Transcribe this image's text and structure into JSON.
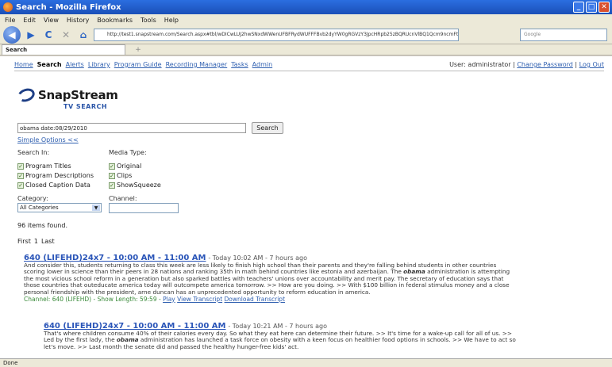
{
  "window": {
    "title": "Search - Mozilla Firefox"
  },
  "menu": [
    "File",
    "Edit",
    "View",
    "History",
    "Bookmarks",
    "Tools",
    "Help"
  ],
  "browser": {
    "url": "http://test1.snapstream.com/Search.aspx#tbl/wDICwLUJ2hwSNxdWWenUFBFRydWUFFFBvb2dyYW0gRGVzY3JpcHRpb25zBQRUcnVlBQ1Qcm9ncmFtVGlt",
    "search_placeholder": "Google",
    "tab_label": "Search"
  },
  "nav": {
    "links": [
      "Home",
      "Search",
      "Alerts",
      "Library",
      "Program Guide",
      "Recording Manager",
      "Tasks",
      "Admin"
    ],
    "current": "Search",
    "user_prefix": "User: administrator |",
    "change_password": "Change Password",
    "separator": "|",
    "logout": "Log Out"
  },
  "logo": {
    "name": "SnapStream",
    "sub": "TV SEARCH"
  },
  "search": {
    "query": "obama date:08/29/2010",
    "button": "Search",
    "simple_options": "Simple Options <<",
    "search_in_label": "Search In:",
    "media_type_label": "Media Type:",
    "search_in": [
      "Program Titles",
      "Program Descriptions",
      "Closed Caption Data"
    ],
    "media_types": [
      "Original",
      "Clips",
      "ShowSqueeze"
    ],
    "category_label": "Category:",
    "category_value": "All Categories",
    "channel_label": "Channel:",
    "channel_value": ""
  },
  "results_summary": {
    "count": "96 items found.",
    "first": "First",
    "page": "1",
    "last": "Last"
  },
  "results": [
    {
      "title": "640 (LIFEHD)24x7 - 10:00 AM - 11:00 AM",
      "meta": "- Today 10:02 AM - 7 hours ago",
      "lines": [
        "And consider this, students returning to class this week are less likely to finish high school than their parents and they're falling behind students in other countries",
        "scoring lower in science than their peers in 28 nations and ranking 35th in math behind countries like estonia and azerbaijan. The obama administration is attempting",
        "the most vicious school reform in a generation but also sparked battles with teachers' unions over accountability and merit pay. The secretary of education says that",
        "those countries that outeducate america today will outcompete america tomorrow. >> How are you doing. >> With $100 billion in federal stimulus money and a close",
        "personal friendship with the president, arne duncan has an unprecedented opportunity to reform education in america."
      ],
      "foot": "Channel: 640 (LIFEHD) - Show Length: 59:59 -",
      "play": "Play",
      "view": "View Transcript",
      "download": "Download Transcript"
    },
    {
      "title": "640 (LIFEHD)24x7 - 10:00 AM - 11:00 AM",
      "meta": "- Today 10:21 AM - 7 hours ago",
      "lines": [
        "That's where children consume 40% of their calories every day. So what they eat here can determine their future. >> It's time for a wake-up call for all of us. >>",
        "Led by the first lady, the obama administration has launched a task force on obesity with a keen focus on healthier food options in schools. >> We have to act so",
        "let's move. >> Last month the senate did and passed the healthy hunger-free kids' act."
      ]
    }
  ],
  "status": "Done"
}
